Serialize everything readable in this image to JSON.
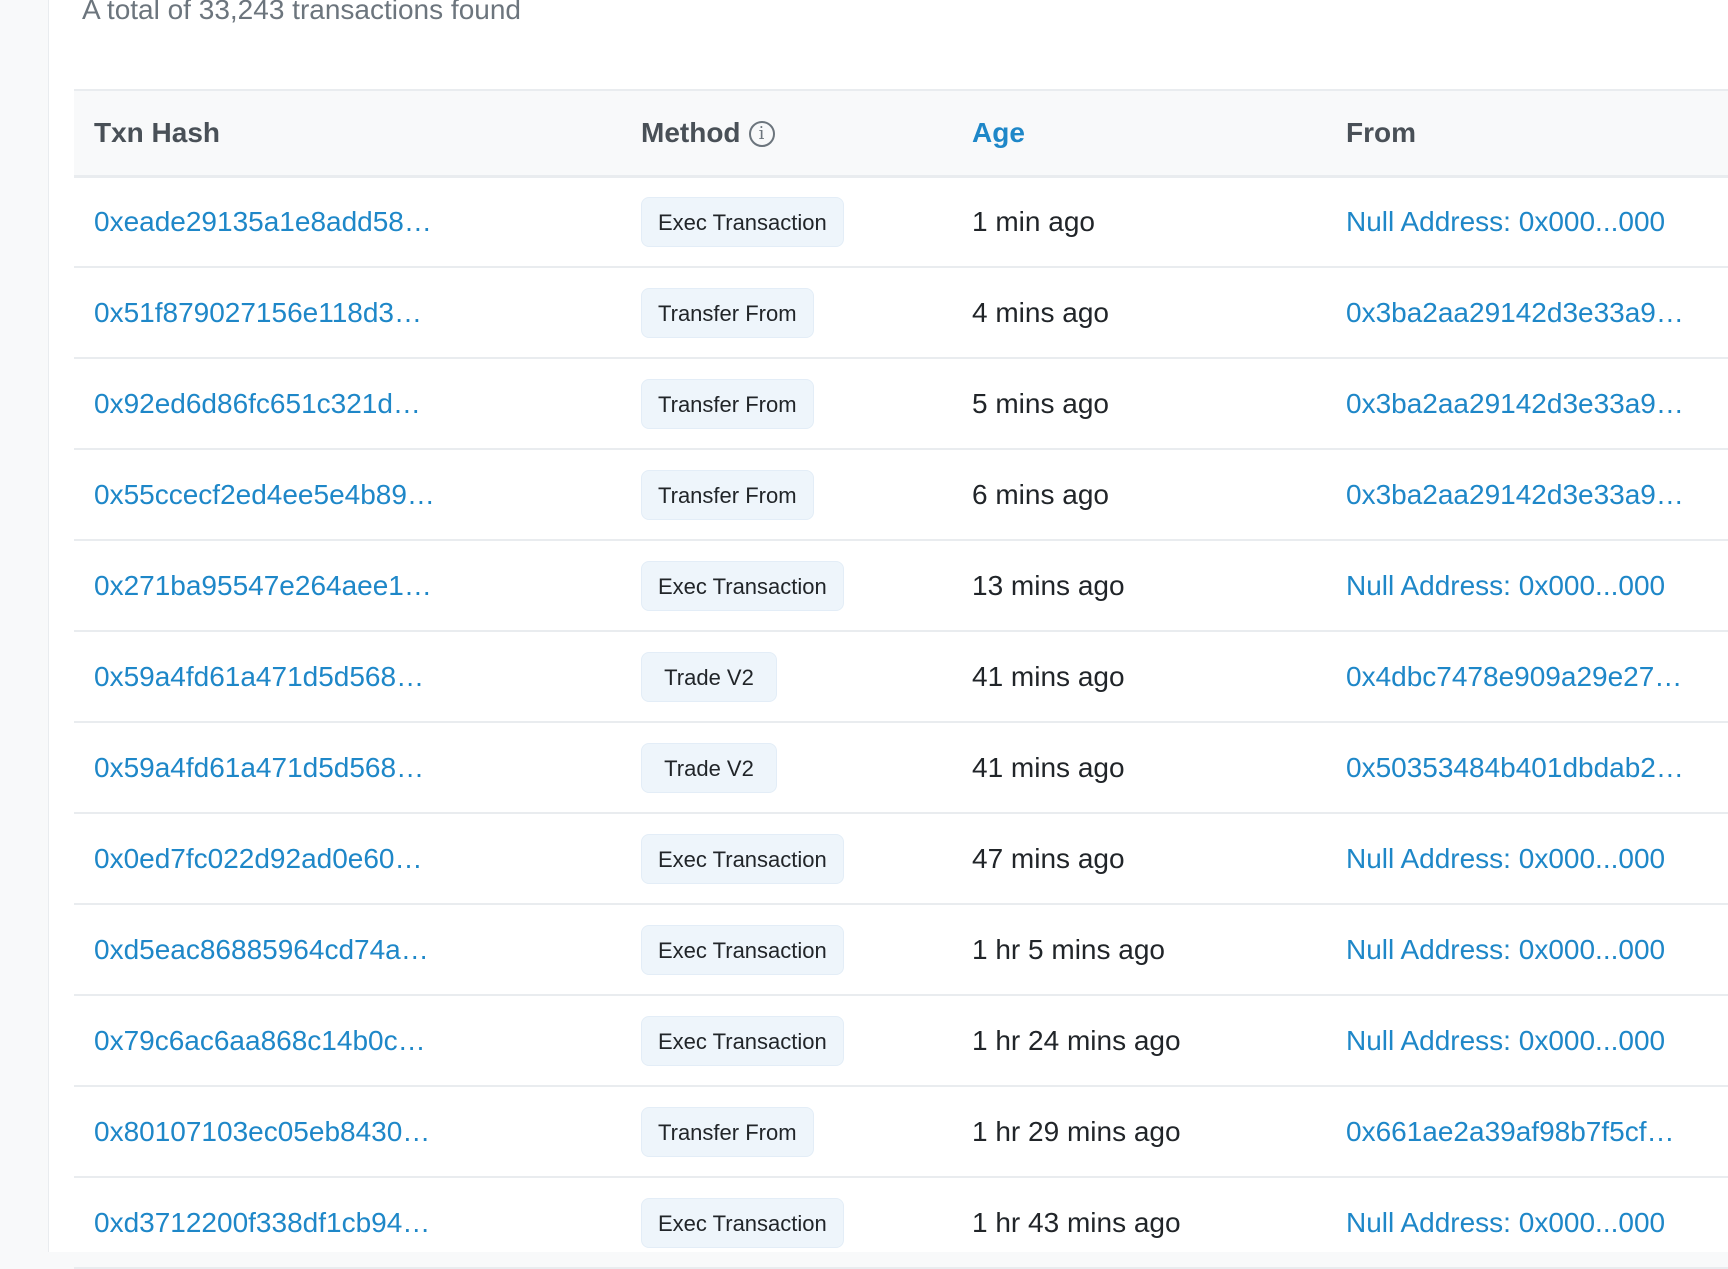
{
  "summary": "A total of 33,243 transactions found",
  "columns": {
    "txn_hash": "Txn Hash",
    "method": "Method",
    "age": "Age",
    "from": "From"
  },
  "icons": {
    "method_info": "info-icon"
  },
  "colors": {
    "link": "#1e87c8",
    "badge_bg": "#eef5fb",
    "header_text": "#495057"
  },
  "rows": [
    {
      "hash": "0xeade29135a1e8add58…",
      "method": "Exec Transaction",
      "age": "1 min ago",
      "from": "Null Address: 0x000...000"
    },
    {
      "hash": "0x51f879027156e118d3…",
      "method": "Transfer From",
      "age": "4 mins ago",
      "from": "0x3ba2aa29142d3e33a9…"
    },
    {
      "hash": "0x92ed6d86fc651c321d…",
      "method": "Transfer From",
      "age": "5 mins ago",
      "from": "0x3ba2aa29142d3e33a9…"
    },
    {
      "hash": "0x55ccecf2ed4ee5e4b89…",
      "method": "Transfer From",
      "age": "6 mins ago",
      "from": "0x3ba2aa29142d3e33a9…"
    },
    {
      "hash": "0x271ba95547e264aee1…",
      "method": "Exec Transaction",
      "age": "13 mins ago",
      "from": "Null Address: 0x000...000"
    },
    {
      "hash": "0x59a4fd61a471d5d568…",
      "method": "Trade V2",
      "age": "41 mins ago",
      "from": "0x4dbc7478e909a29e27…"
    },
    {
      "hash": "0x59a4fd61a471d5d568…",
      "method": "Trade V2",
      "age": "41 mins ago",
      "from": "0x50353484b401dbdab2…"
    },
    {
      "hash": "0x0ed7fc022d92ad0e60…",
      "method": "Exec Transaction",
      "age": "47 mins ago",
      "from": "Null Address: 0x000...000"
    },
    {
      "hash": "0xd5eac86885964cd74a…",
      "method": "Exec Transaction",
      "age": "1 hr 5 mins ago",
      "from": "Null Address: 0x000...000"
    },
    {
      "hash": "0x79c6ac6aa868c14b0c…",
      "method": "Exec Transaction",
      "age": "1 hr 24 mins ago",
      "from": "Null Address: 0x000...000"
    },
    {
      "hash": "0x80107103ec05eb8430…",
      "method": "Transfer From",
      "age": "1 hr 29 mins ago",
      "from": "0x661ae2a39af98b7f5cf…"
    },
    {
      "hash": "0xd3712200f338df1cb94…",
      "method": "Exec Transaction",
      "age": "1 hr 43 mins ago",
      "from": "Null Address: 0x000...000"
    }
  ]
}
